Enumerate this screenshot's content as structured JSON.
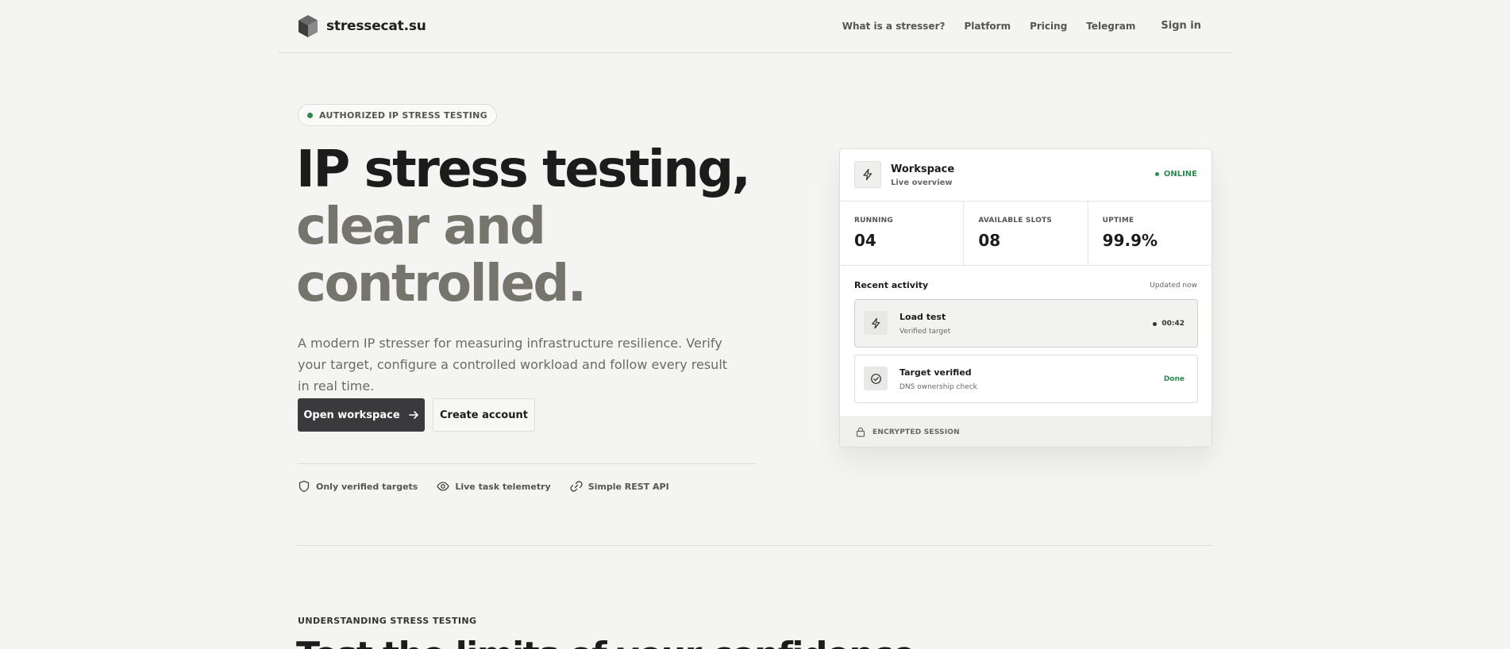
{
  "nav": {
    "brand": "stressecat.su",
    "links": [
      "What is a stresser?",
      "Platform",
      "Pricing",
      "Telegram"
    ],
    "signin": "Sign in"
  },
  "hero": {
    "badge": "AUTHORIZED IP STRESS TESTING",
    "title_line1": "IP stress testing,",
    "title_line2": "clear and",
    "title_line3": "controlled.",
    "lead": "A modern IP stresser for measuring infrastructure resilience. Verify your target, configure a controlled workload and follow every result in real time.",
    "primary_cta": "Open workspace",
    "secondary_cta": "Create account",
    "features": [
      "Only verified targets",
      "Live task telemetry",
      "Simple REST API"
    ]
  },
  "workspace": {
    "title": "Workspace",
    "subtitle": "Live overview",
    "status": "ONLINE",
    "stats": [
      {
        "label": "RUNNING",
        "value": "04"
      },
      {
        "label": "AVAILABLE SLOTS",
        "value": "08"
      },
      {
        "label": "UPTIME",
        "value": "99.9%"
      }
    ],
    "activity_title": "Recent activity",
    "activity_updated": "Updated now",
    "activity": [
      {
        "title": "Load test",
        "sub": "Verified target",
        "right": "00:42"
      },
      {
        "title": "Target verified",
        "sub": "DNS ownership check",
        "right": "Done"
      }
    ],
    "footer": "ENCRYPTED SESSION"
  },
  "section": {
    "eyebrow": "UNDERSTANDING STRESS TESTING",
    "title": "Test the limits of your confidence"
  },
  "colors": {
    "background": "#f4f4f2",
    "accent_green": "#2f8a4f",
    "primary_button": "#3a3a3d",
    "title_muted": "#75756d"
  }
}
